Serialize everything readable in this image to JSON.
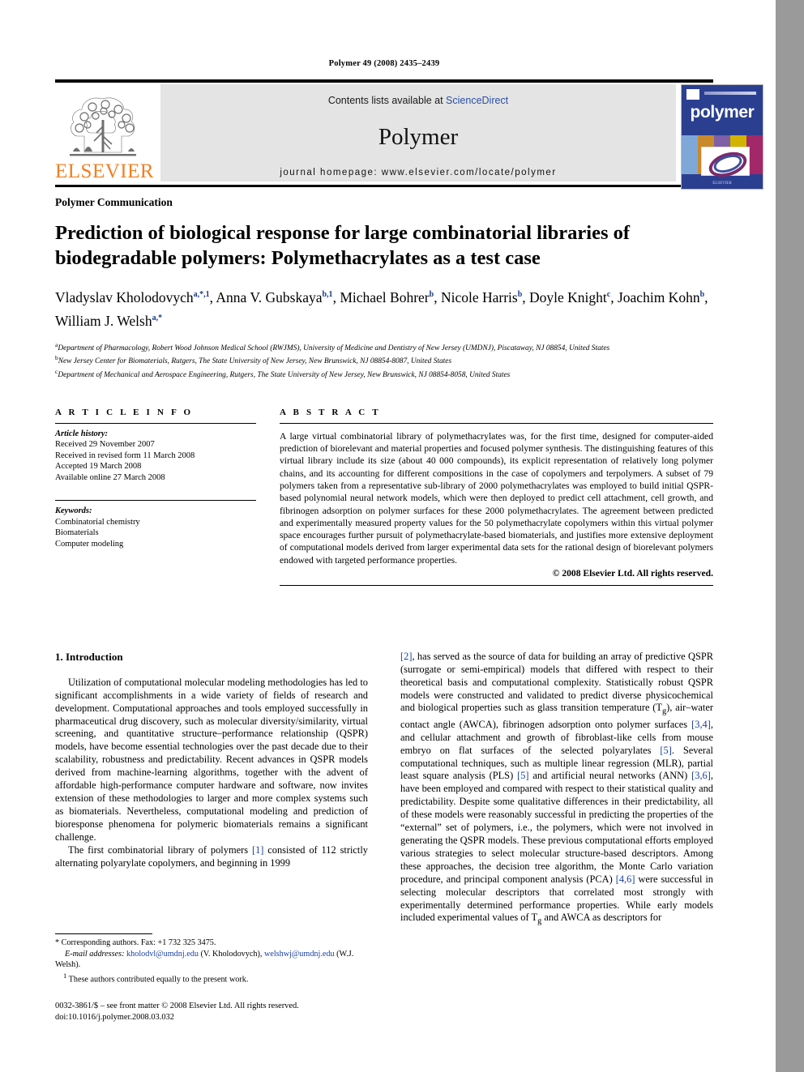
{
  "running_head": "Polymer 49 (2008) 2435–2439",
  "masthead": {
    "contents_prefix": "Contents lists available at ",
    "sciencedirect": "ScienceDirect",
    "journal_title": "Polymer",
    "homepage": "journal homepage: www.elsevier.com/locate/polymer",
    "publisher_logo_text": "ELSEVIER",
    "cover_title": "polymer",
    "cover_footer": "ELSEVIER",
    "link_color": "#2b4ea2",
    "banner_bg": "#e4e4e4",
    "cover_bg": "#2b3f91",
    "elsevier_orange": "#f07f20"
  },
  "article": {
    "section_type": "Polymer Communication",
    "title": "Prediction of biological response for large combinatorial libraries of biodegradable polymers: Polymethacrylates as a test case",
    "authors": [
      {
        "name": "Vladyslav Kholodovych",
        "marks": "a,*,1",
        "sep": ", "
      },
      {
        "name": "Anna V. Gubskaya",
        "marks": "b,1",
        "sep": ", "
      },
      {
        "name": "Michael Bohrer",
        "marks": "b",
        "sep": ", "
      },
      {
        "name": "Nicole Harris",
        "marks": "b",
        "sep": ", "
      },
      {
        "name": "Doyle Knight",
        "marks": "c",
        "sep": ", "
      },
      {
        "name": "Joachim Kohn",
        "marks": "b",
        "sep": ", "
      },
      {
        "name": "William J. Welsh",
        "marks": "a,*",
        "sep": ""
      }
    ],
    "affiliations": [
      {
        "mark": "a",
        "text": "Department of Pharmacology, Robert Wood Johnson Medical School (RWJMS), University of Medicine and Dentistry of New Jersey (UMDNJ), Piscataway, NJ 08854, United States"
      },
      {
        "mark": "b",
        "text": "New Jersey Center for Biomaterials, Rutgers, The State University of New Jersey, New Brunswick, NJ 08854-8087, United States"
      },
      {
        "mark": "c",
        "text": "Department of Mechanical and Aerospace Engineering, Rutgers, The State University of New Jersey, New Brunswick, NJ 08854-8058, United States"
      }
    ]
  },
  "article_info": {
    "heading": "A R T I C L E   I N F O",
    "history_label": "Article history:",
    "history": [
      "Received 29 November 2007",
      "Received in revised form 11 March 2008",
      "Accepted 19 March 2008",
      "Available online 27 March 2008"
    ],
    "keywords_label": "Keywords:",
    "keywords": [
      "Combinatorial chemistry",
      "Biomaterials",
      "Computer modeling"
    ]
  },
  "abstract": {
    "heading": "A B S T R A C T",
    "text": "A large virtual combinatorial library of polymethacrylates was, for the first time, designed for computer-aided prediction of biorelevant and material properties and focused polymer synthesis. The distinguishing features of this virtual library include its size (about 40 000 compounds), its explicit representation of relatively long polymer chains, and its accounting for different compositions in the case of copolymers and terpolymers. A subset of 79 polymers taken from a representative sub-library of 2000 polymethacrylates was employed to build initial QSPR-based polynomial neural network models, which were then deployed to predict cell attachment, cell growth, and fibrinogen adsorption on polymer surfaces for these 2000 polymethacrylates. The agreement between predicted and experimentally measured property values for the 50 polymethacrylate copolymers within this virtual polymer space encourages further pursuit of polymethacrylate-based biomaterials, and justifies more extensive deployment of computational models derived from larger experimental data sets for the rational design of biorelevant polymers endowed with targeted performance properties.",
    "copyright": "© 2008 Elsevier Ltd. All rights reserved."
  },
  "body": {
    "section_heading": "1. Introduction",
    "left_para_1": "Utilization of computational molecular modeling methodologies has led to significant accomplishments in a wide variety of fields of research and development. Computational approaches and tools employed successfully in pharmaceutical drug discovery, such as molecular diversity/similarity, virtual screening, and quantitative structure–performance relationship (QSPR) models, have become essential technologies over the past decade due to their scalability, robustness and predictability. Recent advances in QSPR models derived from machine-learning algorithms, together with the advent of affordable high-performance computer hardware and software, now invites extension of these methodologies to larger and more complex systems such as biomaterials. Nevertheless, computational modeling and prediction of bioresponse phenomena for polymeric biomaterials remains a significant challenge.",
    "left_para_2_pre": "The first combinatorial library of polymers ",
    "left_para_2_ref": "[1]",
    "left_para_2_post": " consisted of 112 strictly alternating polyarylate copolymers, and beginning in 1999",
    "right_segments": [
      {
        "type": "ref",
        "text": "[2]"
      },
      {
        "type": "text",
        "text": ", has served as the source of data for building an array of predictive QSPR (surrogate or semi-empirical) models that differed with respect to their theoretical basis and computational complexity. Statistically robust QSPR models were constructed and validated to predict diverse physicochemical and biological properties such as glass transition temperature (T"
      },
      {
        "type": "sub",
        "text": "g"
      },
      {
        "type": "text",
        "text": "), air–water contact angle (AWCA), fibrinogen adsorption onto polymer surfaces "
      },
      {
        "type": "ref",
        "text": "[3,4]"
      },
      {
        "type": "text",
        "text": ", and cellular attachment and growth of fibroblast-like cells from mouse embryo on flat surfaces of the selected polyarylates "
      },
      {
        "type": "ref",
        "text": "[5]"
      },
      {
        "type": "text",
        "text": ". Several computational techniques, such as multiple linear regression (MLR), partial least square analysis (PLS) "
      },
      {
        "type": "ref",
        "text": "[5]"
      },
      {
        "type": "text",
        "text": " and artificial neural networks (ANN) "
      },
      {
        "type": "ref",
        "text": "[3,6]"
      },
      {
        "type": "text",
        "text": ", have been employed and compared with respect to their statistical quality and predictability. Despite some qualitative differences in their predictability, all of these models were reasonably successful in predicting the properties of the “external” set of polymers, i.e., the polymers, which were not involved in generating the QSPR models. These previous computational efforts employed various strategies to select molecular structure-based descriptors. Among these approaches, the decision tree algorithm, the Monte Carlo variation procedure, and principal component analysis (PCA) "
      },
      {
        "type": "ref",
        "text": "[4,6]"
      },
      {
        "type": "text",
        "text": " were successful in selecting molecular descriptors that correlated most strongly with experimentally determined performance properties. While early models included experimental values of T"
      },
      {
        "type": "sub",
        "text": "g"
      },
      {
        "type": "text",
        "text": " and AWCA as descriptors for"
      }
    ]
  },
  "footnotes": {
    "corresponding": "* Corresponding authors. Fax: +1 732 325 3475.",
    "email_label": "E-mail addresses:",
    "email_1": "kholodvl@umdnj.edu",
    "email_1_after": " (V. Kholodovych), ",
    "email_2": "welshwj@umdnj.edu",
    "email_2_after": " (W.J. Welsh).",
    "equal_contrib_mark": "1",
    "equal_contrib": "These authors contributed equally to the present work.",
    "issn_line": "0032-3861/$ – see front matter © 2008 Elsevier Ltd. All rights reserved.",
    "doi_line": "doi:10.1016/j.polymer.2008.03.032"
  }
}
